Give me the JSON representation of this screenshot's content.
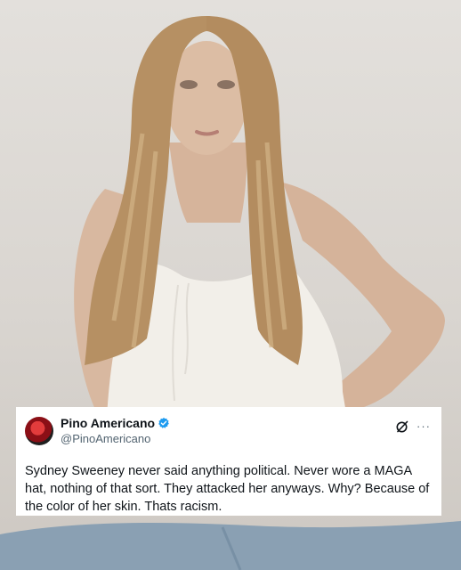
{
  "tweet": {
    "display_name": "Pino Americano",
    "handle": "@PinoAmericano",
    "verified": true,
    "text": "Sydney Sweeney never said anything political. Never wore a MAGA hat, nothing of that sort. They attacked her anyways. Why? Because of the color of her skin. Thats racism.",
    "more_label": "···",
    "icons": {
      "verified": "verified-badge-icon",
      "grok": "grok-icon",
      "more": "more-icon"
    }
  },
  "colors": {
    "verified": "#1d9bf0",
    "text": "#0f1419",
    "secondary": "#536471",
    "card": "#ffffff"
  }
}
